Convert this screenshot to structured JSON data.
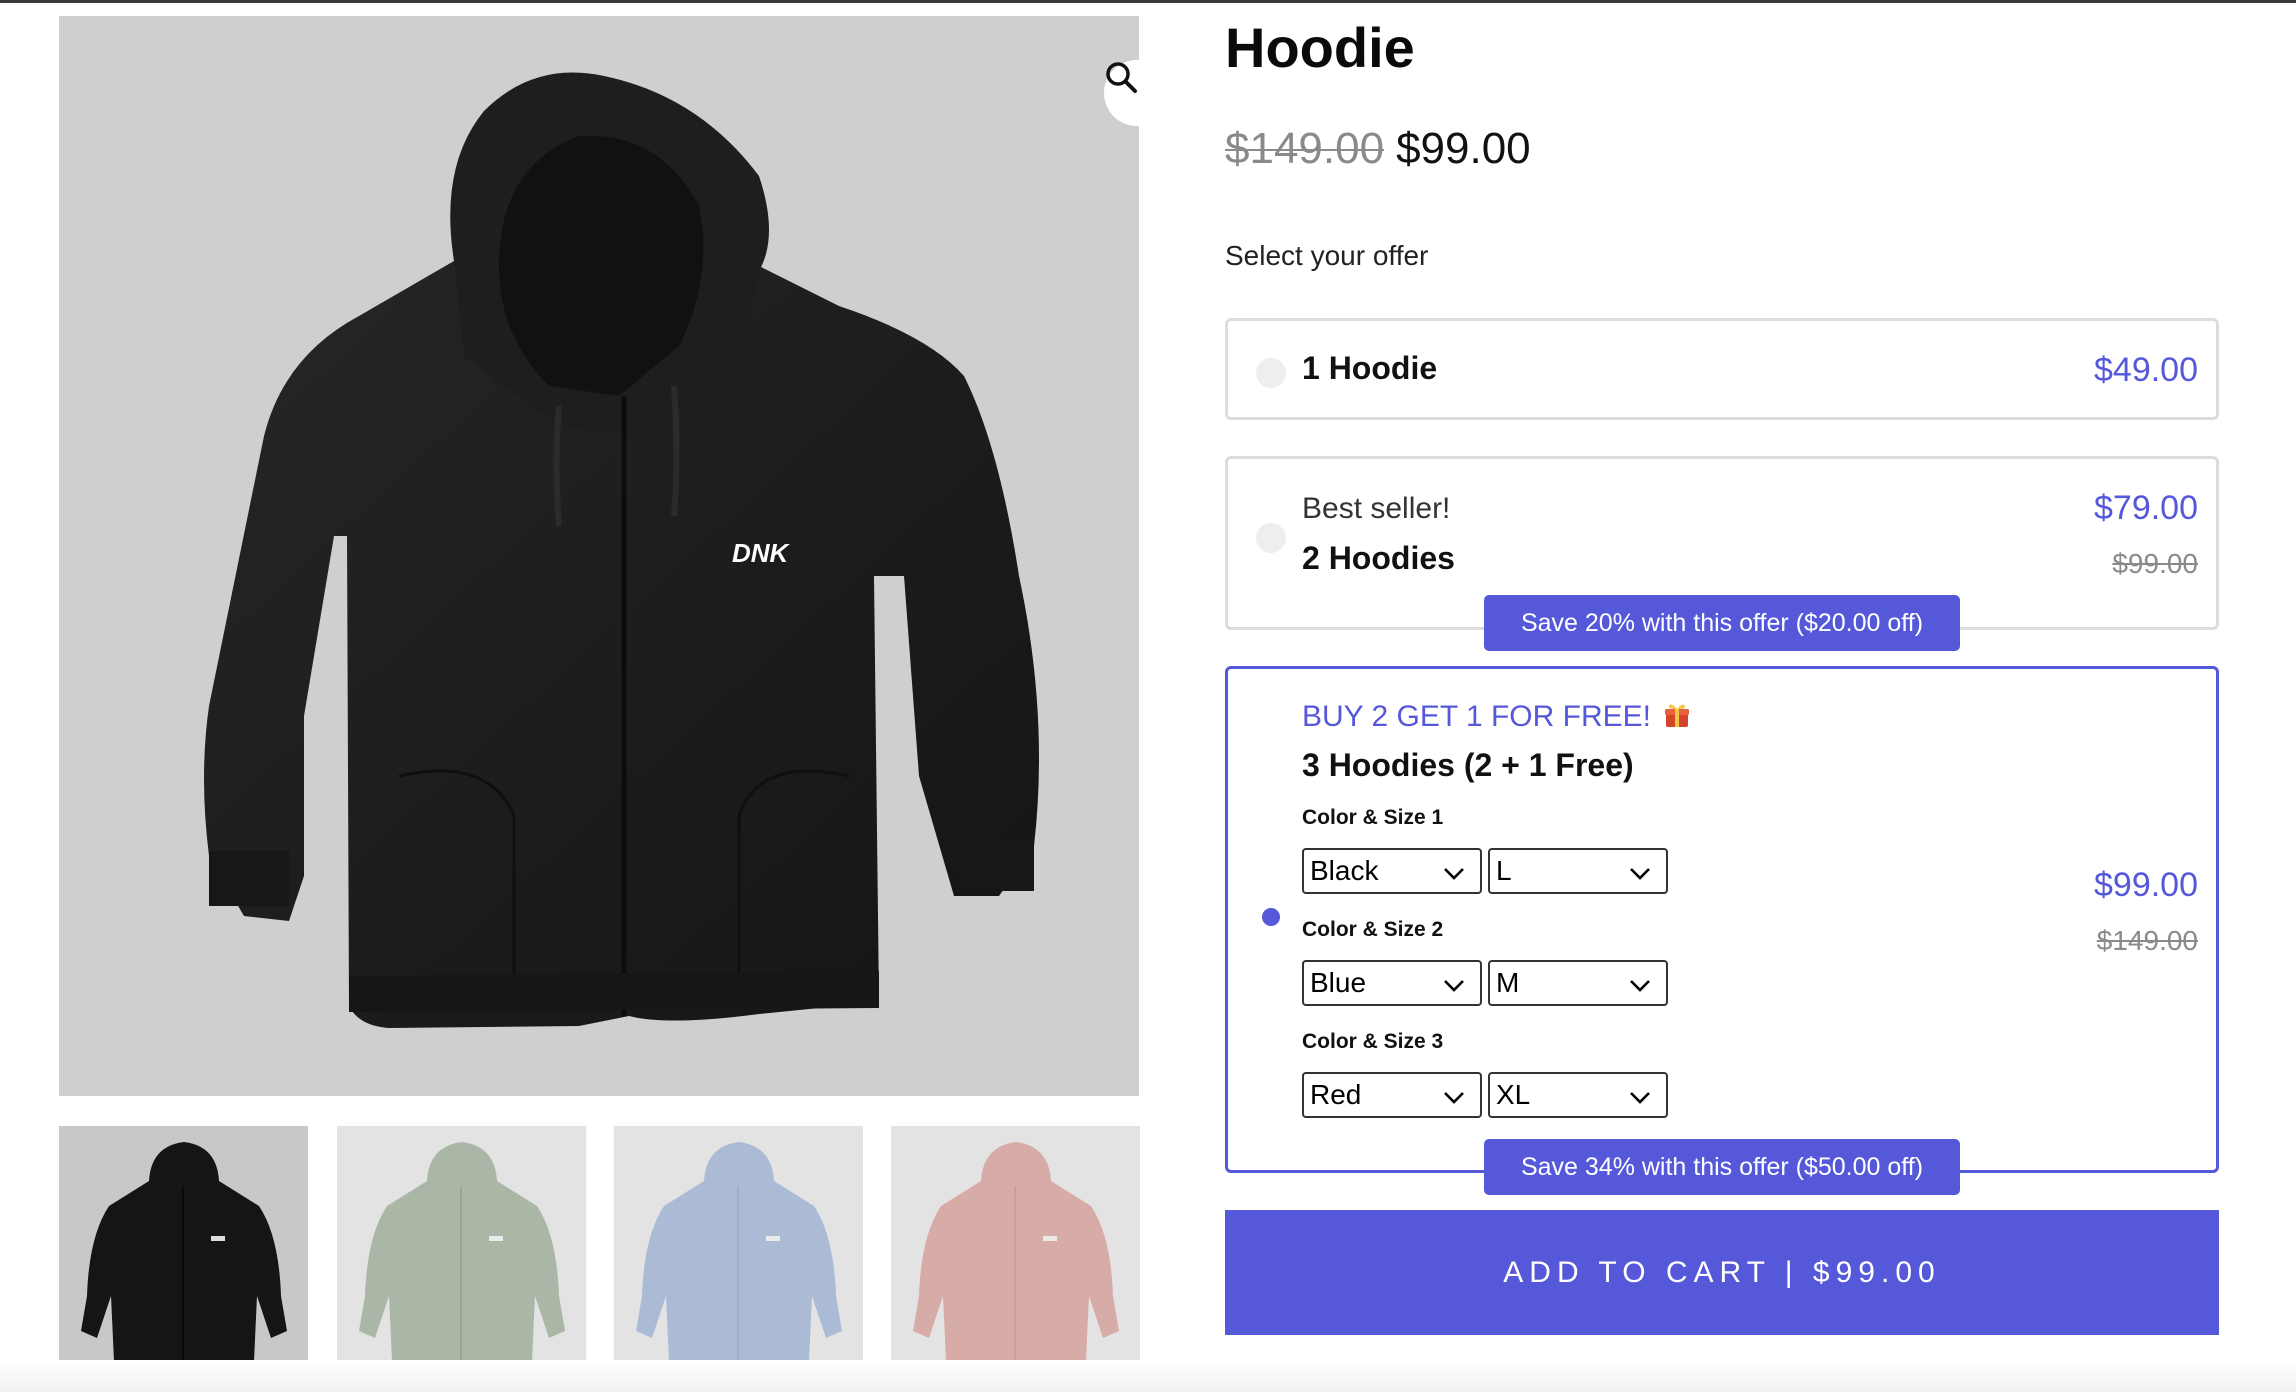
{
  "product": {
    "title": "Hoodie",
    "price_old": "$149.00",
    "price_new": "$99.00"
  },
  "gallery": {
    "main_image_logo": "DNK",
    "zoom_icon": "search-icon",
    "thumbnails": [
      {
        "name": "black-hoodie",
        "color": "#151515"
      },
      {
        "name": "sage-hoodie",
        "color": "#9fae98"
      },
      {
        "name": "blue-hoodie",
        "color": "#a9bddb"
      },
      {
        "name": "pink-hoodie",
        "color": "#d9a39e"
      }
    ]
  },
  "offers": {
    "heading": "Select your offer",
    "items": [
      {
        "label": "1 Hoodie",
        "price": "$49.00",
        "selected": false
      },
      {
        "tag": "Best seller!",
        "label": "2 Hoodies",
        "price": "$79.00",
        "compare_price": "$99.00",
        "badge": "Save 20% with this offer ($20.00 off)",
        "selected": false
      },
      {
        "tag": "BUY 2 GET 1 FOR FREE!",
        "tag_icon": "gift-icon",
        "label": "3 Hoodies (2 + 1 Free)",
        "price": "$99.00",
        "compare_price": "$149.00",
        "badge": "Save 34% with this offer ($50.00 off)",
        "selected": true,
        "variants": [
          {
            "label": "Color & Size 1",
            "color": "Black",
            "size": "L"
          },
          {
            "label": "Color & Size 2",
            "color": "Blue",
            "size": "M"
          },
          {
            "label": "Color & Size 3",
            "color": "Red",
            "size": "XL"
          }
        ]
      }
    ]
  },
  "cart": {
    "button_label": "ADD TO CART | $99.00"
  },
  "colors": {
    "accent": "#5558d9",
    "image_bg": "#cfcfcf",
    "hoodie": "#1c1c1c"
  }
}
